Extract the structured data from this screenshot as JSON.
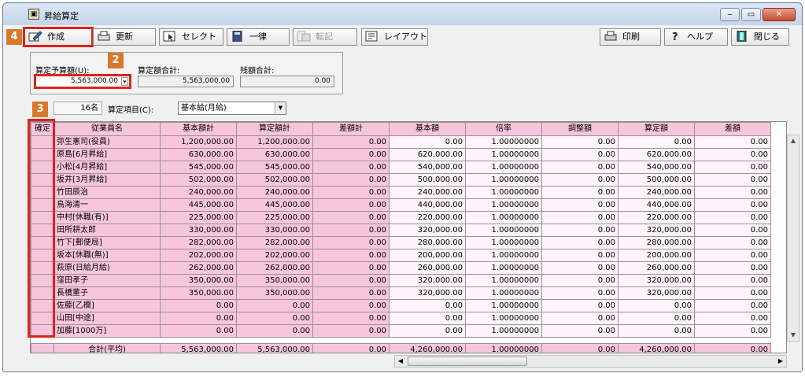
{
  "window": {
    "title": "昇給算定",
    "min": "‒",
    "max": "▭",
    "close": "✕"
  },
  "toolbar": {
    "create": "作成",
    "update": "更新",
    "select": "セレクト",
    "uniform": "一律",
    "transfer": "転記",
    "layout": "レイアウト",
    "print": "印刷",
    "help": "ヘルプ",
    "close": "閉じる"
  },
  "annotations": {
    "b4": "4",
    "b2": "2",
    "b3": "3"
  },
  "budget": {
    "budget_label": "算定予算額(U):",
    "budget_value": "5,563,000.00",
    "total_label": "算定額合計:",
    "total_value": "5,563,000.00",
    "remain_label": "残額合計:",
    "remain_value": "0.00"
  },
  "filter": {
    "count": "16名",
    "item_label": "算定項目(C):",
    "item_value": "基本給(月給)"
  },
  "grid": {
    "headers": [
      "確定",
      "従業員名",
      "基本額計",
      "算定額計",
      "差額計",
      "基本額",
      "倍率",
      "調整額",
      "算定額",
      "差額"
    ],
    "rows": [
      [
        "",
        "弥生憲司(役員)",
        "1,200,000.00",
        "1,200,000.00",
        "0.00",
        "0.00",
        "1.00000000",
        "0.00",
        "0.00",
        "0.00"
      ],
      [
        "",
        "原島[6月昇給]",
        "630,000.00",
        "630,000.00",
        "0.00",
        "620,000.00",
        "1.00000000",
        "0.00",
        "620,000.00",
        "0.00"
      ],
      [
        "",
        "小松[4月昇給]",
        "545,000.00",
        "545,000.00",
        "0.00",
        "540,000.00",
        "1.00000000",
        "0.00",
        "540,000.00",
        "0.00"
      ],
      [
        "",
        "坂井[3月昇給]",
        "502,000.00",
        "502,000.00",
        "0.00",
        "500,000.00",
        "1.00000000",
        "0.00",
        "500,000.00",
        "0.00"
      ],
      [
        "",
        "竹田辰治",
        "240,000.00",
        "240,000.00",
        "0.00",
        "240,000.00",
        "1.00000000",
        "0.00",
        "240,000.00",
        "0.00"
      ],
      [
        "",
        "鳥海清一",
        "445,000.00",
        "445,000.00",
        "0.00",
        "440,000.00",
        "1.00000000",
        "0.00",
        "440,000.00",
        "0.00"
      ],
      [
        "",
        "中村[休職(有)]",
        "225,000.00",
        "225,000.00",
        "0.00",
        "220,000.00",
        "1.00000000",
        "0.00",
        "220,000.00",
        "0.00"
      ],
      [
        "",
        "田所耕太郎",
        "330,000.00",
        "330,000.00",
        "0.00",
        "320,000.00",
        "1.00000000",
        "0.00",
        "320,000.00",
        "0.00"
      ],
      [
        "",
        "竹下[郵便局]",
        "282,000.00",
        "282,000.00",
        "0.00",
        "280,000.00",
        "1.00000000",
        "0.00",
        "280,000.00",
        "0.00"
      ],
      [
        "",
        "坂本[休職(無)]",
        "202,000.00",
        "202,000.00",
        "0.00",
        "200,000.00",
        "1.00000000",
        "0.00",
        "200,000.00",
        "0.00"
      ],
      [
        "",
        "萩原(日給月給)",
        "262,000.00",
        "262,000.00",
        "0.00",
        "260,000.00",
        "1.00000000",
        "0.00",
        "260,000.00",
        "0.00"
      ],
      [
        "",
        "窪田孝子",
        "350,000.00",
        "350,000.00",
        "0.00",
        "320,000.00",
        "1.00000000",
        "0.00",
        "320,000.00",
        "0.00"
      ],
      [
        "",
        "長橋董子",
        "350,000.00",
        "350,000.00",
        "0.00",
        "320,000.00",
        "1.00000000",
        "0.00",
        "320,000.00",
        "0.00"
      ],
      [
        "",
        "佐藤[乙欄]",
        "0.00",
        "0.00",
        "0.00",
        "0.00",
        "1.00000000",
        "0.00",
        "0.00",
        "0.00"
      ],
      [
        "",
        "山田[中途]",
        "0.00",
        "0.00",
        "0.00",
        "0.00",
        "1.00000000",
        "0.00",
        "0.00",
        "0.00"
      ],
      [
        "",
        "加藤[1000万]",
        "0.00",
        "0.00",
        "0.00",
        "0.00",
        "1.00000000",
        "0.00",
        "0.00",
        "0.00"
      ]
    ],
    "total": [
      "",
      "合計(平均)",
      "5,563,000.00",
      "5,563,000.00",
      "0.00",
      "4,260,000.00",
      "1.00000000",
      "0.00",
      "4,260,000.00",
      "0.00"
    ]
  }
}
